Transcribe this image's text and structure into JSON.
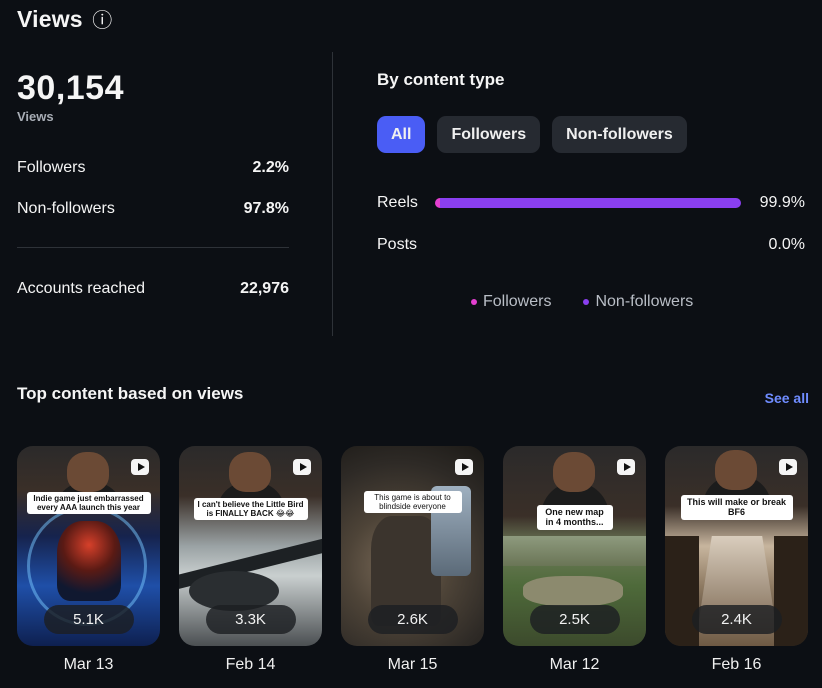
{
  "header": {
    "title": "Views",
    "info_icon": "ⓘ"
  },
  "summary": {
    "total_views": "30,154",
    "total_label": "Views",
    "followers_label": "Followers",
    "followers_pct": "2.2%",
    "nonfollowers_label": "Non-followers",
    "nonfollowers_pct": "97.8%",
    "reached_label": "Accounts reached",
    "reached_value": "22,976"
  },
  "by_content": {
    "title": "By content type",
    "chips": [
      "All",
      "Followers",
      "Non-followers"
    ],
    "active_chip": "All",
    "rows": [
      {
        "label": "Reels",
        "pct": "99.9%",
        "fill": 0.999,
        "followers_share": 0.022
      },
      {
        "label": "Posts",
        "pct": "0.0%",
        "fill": 0.0,
        "followers_share": 0.0
      }
    ],
    "legend": [
      {
        "label": "Followers",
        "color": "#e43fd0"
      },
      {
        "label": "Non-followers",
        "color": "#8a3ff0"
      }
    ]
  },
  "top_content": {
    "title": "Top content based on views",
    "see_all": "See all",
    "items": [
      {
        "caption": "Indie game just embarrassed every AAA launch this year",
        "views": "5.1K",
        "date": "Mar 13"
      },
      {
        "caption": "I can't believe the Little Bird is FINALLY BACK 😂😂",
        "views": "3.3K",
        "date": "Feb 14"
      },
      {
        "caption": "This game is about to blindside everyone",
        "views": "2.6K",
        "date": "Mar 15"
      },
      {
        "caption": "One new map in 4 months...",
        "views": "2.5K",
        "date": "Mar 12"
      },
      {
        "caption": "This will make or break BF6",
        "views": "2.4K",
        "date": "Feb 16"
      }
    ]
  },
  "colors": {
    "accent_chip": "#4a5df5",
    "followers": "#e43fd0",
    "nonfollowers": "#8a3ff0",
    "link": "#6f8cff"
  }
}
